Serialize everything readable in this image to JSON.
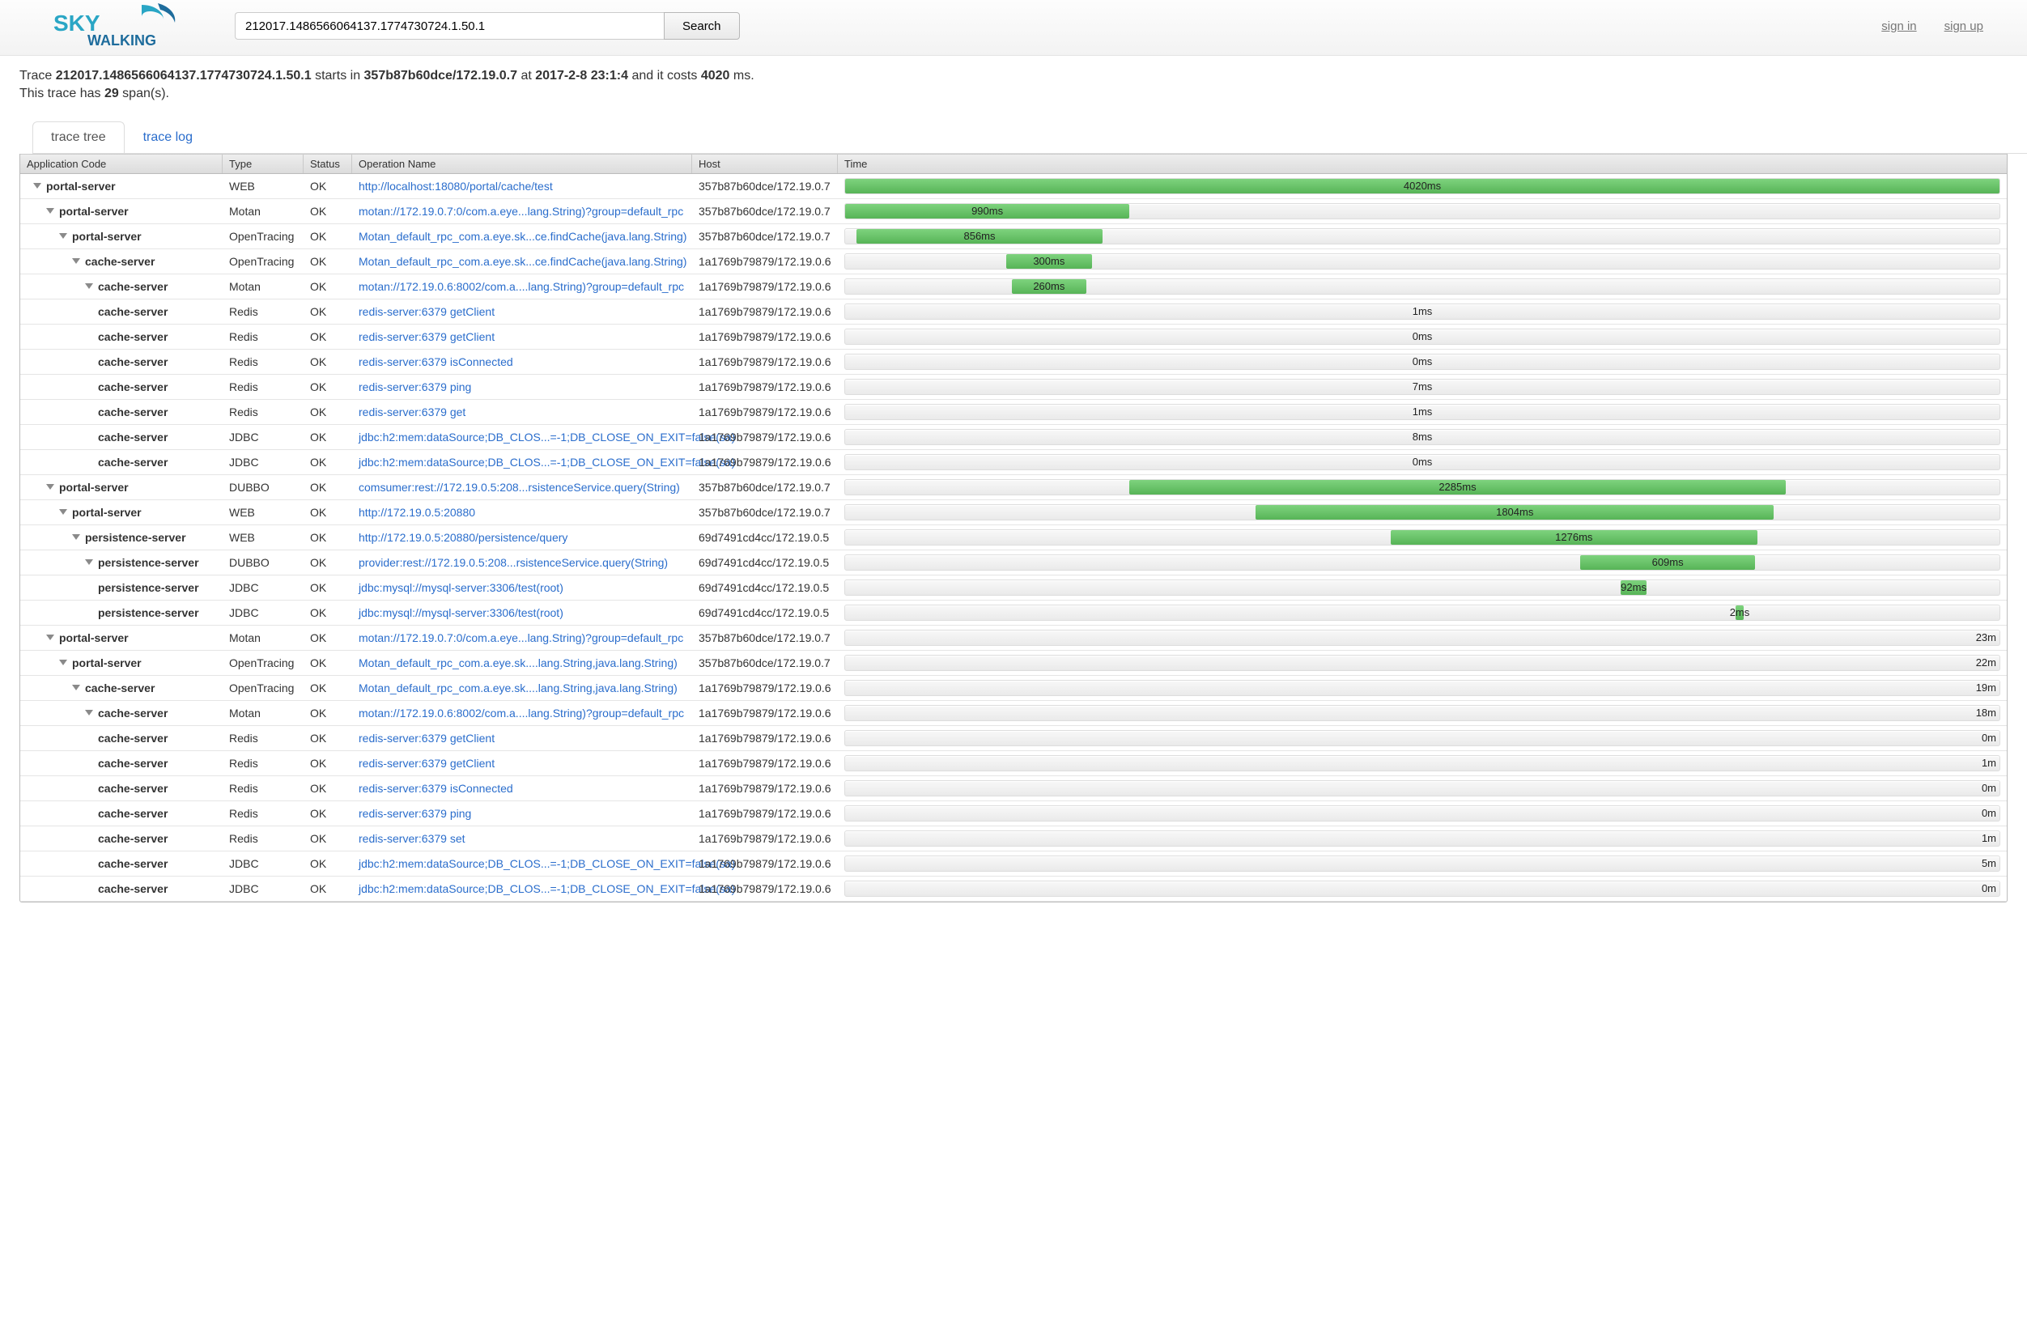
{
  "header": {
    "search_value": "212017.1486566064137.1774730724.1.50.1",
    "search_btn": "Search",
    "sign_in": "sign in",
    "sign_up": "sign up",
    "logo_top": "SKY",
    "logo_bottom": "WALKING"
  },
  "summary": {
    "prefix": "Trace ",
    "trace_id": "212017.1486566064137.1774730724.1.50.1",
    "mid1": " starts in ",
    "host": "357b87b60dce/172.19.0.7",
    "mid2": " at ",
    "time": "2017-2-8 23:1:4",
    "mid3": " and it costs ",
    "cost": "4020",
    "mid4": " ms.",
    "line2a": "This trace has ",
    "spans": "29",
    "line2b": " span(s)."
  },
  "tabs": {
    "tree": "trace tree",
    "log": "trace log"
  },
  "table": {
    "headers": {
      "app": "Application Code",
      "type": "Type",
      "status": "Status",
      "op": "Operation Name",
      "host": "Host",
      "time": "Time"
    },
    "total_ms": 4020,
    "rows": [
      {
        "depth": 0,
        "exp": true,
        "app": "portal-server",
        "type": "WEB",
        "status": "OK",
        "op": "http://localhost:18080/portal/cache/test",
        "host": "357b87b60dce/172.19.0.7",
        "label": "4020ms",
        "offset": 0,
        "dur": 4020
      },
      {
        "depth": 1,
        "exp": true,
        "app": "portal-server",
        "type": "Motan",
        "status": "OK",
        "op": "motan://172.19.0.7:0/com.a.eye...lang.String)?group=default_rpc",
        "host": "357b87b60dce/172.19.0.7",
        "label": "990ms",
        "offset": 0,
        "dur": 990
      },
      {
        "depth": 2,
        "exp": true,
        "app": "portal-server",
        "type": "OpenTracing",
        "status": "OK",
        "op": "Motan_default_rpc_com.a.eye.sk...ce.findCache(java.lang.String)",
        "host": "357b87b60dce/172.19.0.7",
        "label": "856ms",
        "offset": 40,
        "dur": 856
      },
      {
        "depth": 3,
        "exp": true,
        "app": "cache-server",
        "type": "OpenTracing",
        "status": "OK",
        "op": "Motan_default_rpc_com.a.eye.sk...ce.findCache(java.lang.String)",
        "host": "1a1769b79879/172.19.0.6",
        "label": "300ms",
        "offset": 560,
        "dur": 300
      },
      {
        "depth": 4,
        "exp": true,
        "app": "cache-server",
        "type": "Motan",
        "status": "OK",
        "op": "motan://172.19.0.6:8002/com.a....lang.String)?group=default_rpc",
        "host": "1a1769b79879/172.19.0.6",
        "label": "260ms",
        "offset": 580,
        "dur": 260
      },
      {
        "depth": 5,
        "exp": false,
        "app": "cache-server",
        "type": "Redis",
        "status": "OK",
        "op": "redis-server:6379 getClient",
        "host": "1a1769b79879/172.19.0.6",
        "label": "1ms",
        "offset": 0,
        "dur": 4020,
        "gray": true
      },
      {
        "depth": 5,
        "exp": false,
        "app": "cache-server",
        "type": "Redis",
        "status": "OK",
        "op": "redis-server:6379 getClient",
        "host": "1a1769b79879/172.19.0.6",
        "label": "0ms",
        "offset": 0,
        "dur": 4020,
        "gray": true
      },
      {
        "depth": 5,
        "exp": false,
        "app": "cache-server",
        "type": "Redis",
        "status": "OK",
        "op": "redis-server:6379 isConnected",
        "host": "1a1769b79879/172.19.0.6",
        "label": "0ms",
        "offset": 0,
        "dur": 4020,
        "gray": true
      },
      {
        "depth": 5,
        "exp": false,
        "app": "cache-server",
        "type": "Redis",
        "status": "OK",
        "op": "redis-server:6379 ping",
        "host": "1a1769b79879/172.19.0.6",
        "label": "7ms",
        "offset": 0,
        "dur": 4020,
        "gray": true
      },
      {
        "depth": 5,
        "exp": false,
        "app": "cache-server",
        "type": "Redis",
        "status": "OK",
        "op": "redis-server:6379 get",
        "host": "1a1769b79879/172.19.0.6",
        "label": "1ms",
        "offset": 0,
        "dur": 4020,
        "gray": true
      },
      {
        "depth": 5,
        "exp": false,
        "app": "cache-server",
        "type": "JDBC",
        "status": "OK",
        "op": "jdbc:h2:mem:dataSource;DB_CLOS...=-1;DB_CLOSE_ON_EXIT=false(sa)",
        "host": "1a1769b79879/172.19.0.6",
        "label": "8ms",
        "offset": 0,
        "dur": 4020,
        "gray": true
      },
      {
        "depth": 5,
        "exp": false,
        "app": "cache-server",
        "type": "JDBC",
        "status": "OK",
        "op": "jdbc:h2:mem:dataSource;DB_CLOS...=-1;DB_CLOSE_ON_EXIT=false(sa)",
        "host": "1a1769b79879/172.19.0.6",
        "label": "0ms",
        "offset": 0,
        "dur": 4020,
        "gray": true
      },
      {
        "depth": 1,
        "exp": true,
        "app": "portal-server",
        "type": "DUBBO",
        "status": "OK",
        "op": "comsumer:rest://172.19.0.5:208...rsistenceService.query(String)",
        "host": "357b87b60dce/172.19.0.7",
        "label": "2285ms",
        "offset": 990,
        "dur": 2285
      },
      {
        "depth": 2,
        "exp": true,
        "app": "portal-server",
        "type": "WEB",
        "status": "OK",
        "op": "http://172.19.0.5:20880",
        "host": "357b87b60dce/172.19.0.7",
        "label": "1804ms",
        "offset": 1430,
        "dur": 1804
      },
      {
        "depth": 3,
        "exp": true,
        "app": "persistence-server",
        "type": "WEB",
        "status": "OK",
        "op": "http://172.19.0.5:20880/persistence/query",
        "host": "69d7491cd4cc/172.19.0.5",
        "label": "1276ms",
        "offset": 1900,
        "dur": 1276
      },
      {
        "depth": 4,
        "exp": true,
        "app": "persistence-server",
        "type": "DUBBO",
        "status": "OK",
        "op": "provider:rest://172.19.0.5:208...rsistenceService.query(String)",
        "host": "69d7491cd4cc/172.19.0.5",
        "label": "609ms",
        "offset": 2560,
        "dur": 609
      },
      {
        "depth": 5,
        "exp": false,
        "app": "persistence-server",
        "type": "JDBC",
        "status": "OK",
        "op": "jdbc:mysql://mysql-server:3306/test(root)",
        "host": "69d7491cd4cc/172.19.0.5",
        "label": "92ms",
        "offset": 2700,
        "dur": 92
      },
      {
        "depth": 5,
        "exp": false,
        "app": "persistence-server",
        "type": "JDBC",
        "status": "OK",
        "op": "jdbc:mysql://mysql-server:3306/test(root)",
        "host": "69d7491cd4cc/172.19.0.5",
        "label": "2ms",
        "offset": 3100,
        "dur": 30
      },
      {
        "depth": 1,
        "exp": true,
        "app": "portal-server",
        "type": "Motan",
        "status": "OK",
        "op": "motan://172.19.0.7:0/com.a.eye...lang.String)?group=default_rpc",
        "host": "357b87b60dce/172.19.0.7",
        "label": "23m",
        "offset": 0,
        "dur": 4020,
        "gray": true,
        "right": true
      },
      {
        "depth": 2,
        "exp": true,
        "app": "portal-server",
        "type": "OpenTracing",
        "status": "OK",
        "op": "Motan_default_rpc_com.a.eye.sk....lang.String,java.lang.String)",
        "host": "357b87b60dce/172.19.0.7",
        "label": "22m",
        "offset": 0,
        "dur": 4020,
        "gray": true,
        "right": true
      },
      {
        "depth": 3,
        "exp": true,
        "app": "cache-server",
        "type": "OpenTracing",
        "status": "OK",
        "op": "Motan_default_rpc_com.a.eye.sk....lang.String,java.lang.String)",
        "host": "1a1769b79879/172.19.0.6",
        "label": "19m",
        "offset": 0,
        "dur": 4020,
        "gray": true,
        "right": true
      },
      {
        "depth": 4,
        "exp": true,
        "app": "cache-server",
        "type": "Motan",
        "status": "OK",
        "op": "motan://172.19.0.6:8002/com.a....lang.String)?group=default_rpc",
        "host": "1a1769b79879/172.19.0.6",
        "label": "18m",
        "offset": 0,
        "dur": 4020,
        "gray": true,
        "right": true
      },
      {
        "depth": 5,
        "exp": false,
        "app": "cache-server",
        "type": "Redis",
        "status": "OK",
        "op": "redis-server:6379 getClient",
        "host": "1a1769b79879/172.19.0.6",
        "label": "0m",
        "offset": 0,
        "dur": 4020,
        "gray": true,
        "right": true
      },
      {
        "depth": 5,
        "exp": false,
        "app": "cache-server",
        "type": "Redis",
        "status": "OK",
        "op": "redis-server:6379 getClient",
        "host": "1a1769b79879/172.19.0.6",
        "label": "1m",
        "offset": 0,
        "dur": 4020,
        "gray": true,
        "right": true
      },
      {
        "depth": 5,
        "exp": false,
        "app": "cache-server",
        "type": "Redis",
        "status": "OK",
        "op": "redis-server:6379 isConnected",
        "host": "1a1769b79879/172.19.0.6",
        "label": "0m",
        "offset": 0,
        "dur": 4020,
        "gray": true,
        "right": true
      },
      {
        "depth": 5,
        "exp": false,
        "app": "cache-server",
        "type": "Redis",
        "status": "OK",
        "op": "redis-server:6379 ping",
        "host": "1a1769b79879/172.19.0.6",
        "label": "0m",
        "offset": 0,
        "dur": 4020,
        "gray": true,
        "right": true
      },
      {
        "depth": 5,
        "exp": false,
        "app": "cache-server",
        "type": "Redis",
        "status": "OK",
        "op": "redis-server:6379 set",
        "host": "1a1769b79879/172.19.0.6",
        "label": "1m",
        "offset": 0,
        "dur": 4020,
        "gray": true,
        "right": true
      },
      {
        "depth": 5,
        "exp": false,
        "app": "cache-server",
        "type": "JDBC",
        "status": "OK",
        "op": "jdbc:h2:mem:dataSource;DB_CLOS...=-1;DB_CLOSE_ON_EXIT=false(sa)",
        "host": "1a1769b79879/172.19.0.6",
        "label": "5m",
        "offset": 0,
        "dur": 4020,
        "gray": true,
        "right": true
      },
      {
        "depth": 5,
        "exp": false,
        "app": "cache-server",
        "type": "JDBC",
        "status": "OK",
        "op": "jdbc:h2:mem:dataSource;DB_CLOS...=-1;DB_CLOSE_ON_EXIT=false(sa)",
        "host": "1a1769b79879/172.19.0.6",
        "label": "0m",
        "offset": 0,
        "dur": 4020,
        "gray": true,
        "right": true
      }
    ]
  }
}
